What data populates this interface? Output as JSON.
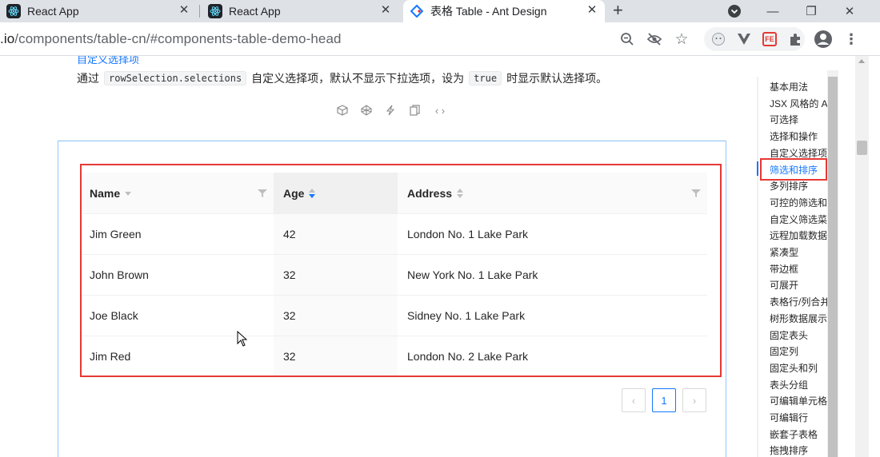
{
  "browser": {
    "tabs": [
      {
        "title": "React App",
        "active": false
      },
      {
        "title": "React App",
        "active": false
      },
      {
        "title": "表格 Table - Ant Design",
        "active": true
      }
    ],
    "url_host": ".io",
    "url_path": "/components/table-cn/#components-table-demo-head",
    "extension_badge": "FE"
  },
  "doc": {
    "link_text": "自定义选择项",
    "desc_before": "通过",
    "code1": "rowSelection.selections",
    "desc_middle": "自定义选择项，默认不显示下拉选项，设为",
    "code2": "true",
    "desc_after": "时显示默认选择项。"
  },
  "table": {
    "columns": [
      "Name",
      "Age",
      "Address"
    ],
    "rows": [
      {
        "name": "Jim Green",
        "age": "42",
        "address": "London No. 1 Lake Park"
      },
      {
        "name": "John Brown",
        "age": "32",
        "address": "New York No. 1 Lake Park"
      },
      {
        "name": "Joe Black",
        "age": "32",
        "address": "Sidney No. 1 Lake Park"
      },
      {
        "name": "Jim Red",
        "age": "32",
        "address": "London No. 2 Lake Park"
      }
    ]
  },
  "pagination": {
    "current": "1"
  },
  "anchor": {
    "items": [
      "基本用法",
      "JSX 风格的 API",
      "可选择",
      "选择和操作",
      "自定义选择项",
      "筛选和排序",
      "多列排序",
      "可控的筛选和排序",
      "自定义筛选菜单",
      "远程加载数据",
      "紧凑型",
      "带边框",
      "可展开",
      "表格行/列合并",
      "树形数据展示",
      "固定表头",
      "固定列",
      "固定头和列",
      "表头分组",
      "可编辑单元格",
      "可编辑行",
      "嵌套子表格",
      "拖拽排序"
    ],
    "active_index": 5
  },
  "colors": {
    "accent": "#1677ff",
    "highlight": "#e53935"
  }
}
